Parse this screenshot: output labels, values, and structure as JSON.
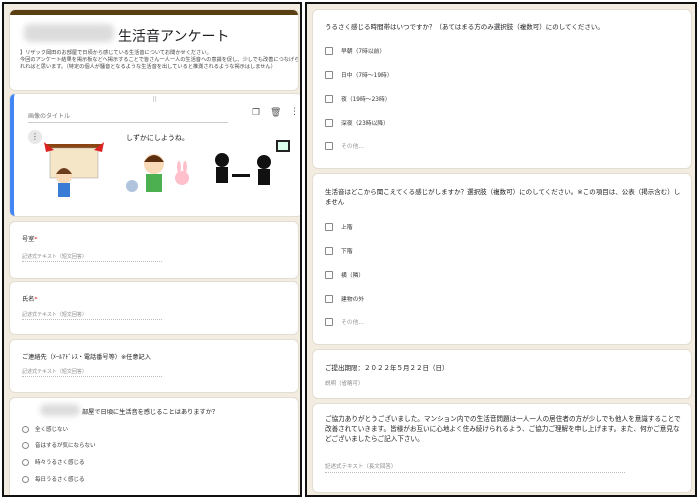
{
  "form": {
    "title": "生活音アンケート",
    "description": "】リザック岡田のお部屋で日頃から感じている生活音についてお聞かせください。\n今回のアンケート結果を掲示板などへ掲示することで皆さん一人一人の生活音への意識を促し、少しでも改善につなげられればと思います。（特定の個人が騒音となるような生活音を出していると推測されるような掲示はしません）"
  },
  "image_card": {
    "title_placeholder": "画像のタイトル",
    "banner_text": "しずかにしようね。"
  },
  "questions_left": [
    {
      "label": "号室",
      "required": true,
      "answer_hint": "記述式テキスト（短文回答）"
    },
    {
      "label": "氏名",
      "required": true,
      "answer_hint": "記述式テキスト（短文回答）"
    },
    {
      "label": "ご連絡先（ﾒｰﾙｱﾄﾞﾚｽ・電話番号等）※任意記入",
      "required": false,
      "answer_hint": "記述式テキスト（短文回答）"
    }
  ],
  "q_noise": {
    "label": "部屋で日頃に生活音を感じることはありますか？",
    "options": [
      "全く感じない",
      "音はするが気にならない",
      "時々うるさく感じる",
      "毎日うるさく感じる"
    ]
  },
  "q_time": {
    "label": "うるさく感じる時間帯はいつですか？（あてはまる方のみ選択肢（複数可）にのしてください。",
    "options": [
      "早朝（7時以前）",
      "日中（7時〜19時）",
      "夜（19時〜23時）",
      "深夜（23時以降）",
      "その他..."
    ]
  },
  "q_place": {
    "label": "生活音はどこから聞こえてくる感じがしますか？選択肢（複数可）にのしてください。※この項目は、公表（掲示含む）しません",
    "options": [
      "上階",
      "下階",
      "横（隣）",
      "建物の外",
      "その他..."
    ]
  },
  "deadline": {
    "label": "ご提出期限：２０２２年５月２２日（日）",
    "hint": "説明（省略可）"
  },
  "closing": {
    "text": "ご協力ありがとうございました。マンション内での生活音問題は一人一人の居住者の方が少しでも他人を意識することで改善されていきます。皆様がお互いに心地よく住み続けられるよう、ご協力ご理解を申し上げます。また、何かご意見などございましたらご記入下さい。",
    "answer_hint": "記述式テキスト（長文回答）"
  },
  "colors": {
    "accent": "#5a3f12",
    "background": "#f2ece1",
    "required": "#d93025"
  }
}
